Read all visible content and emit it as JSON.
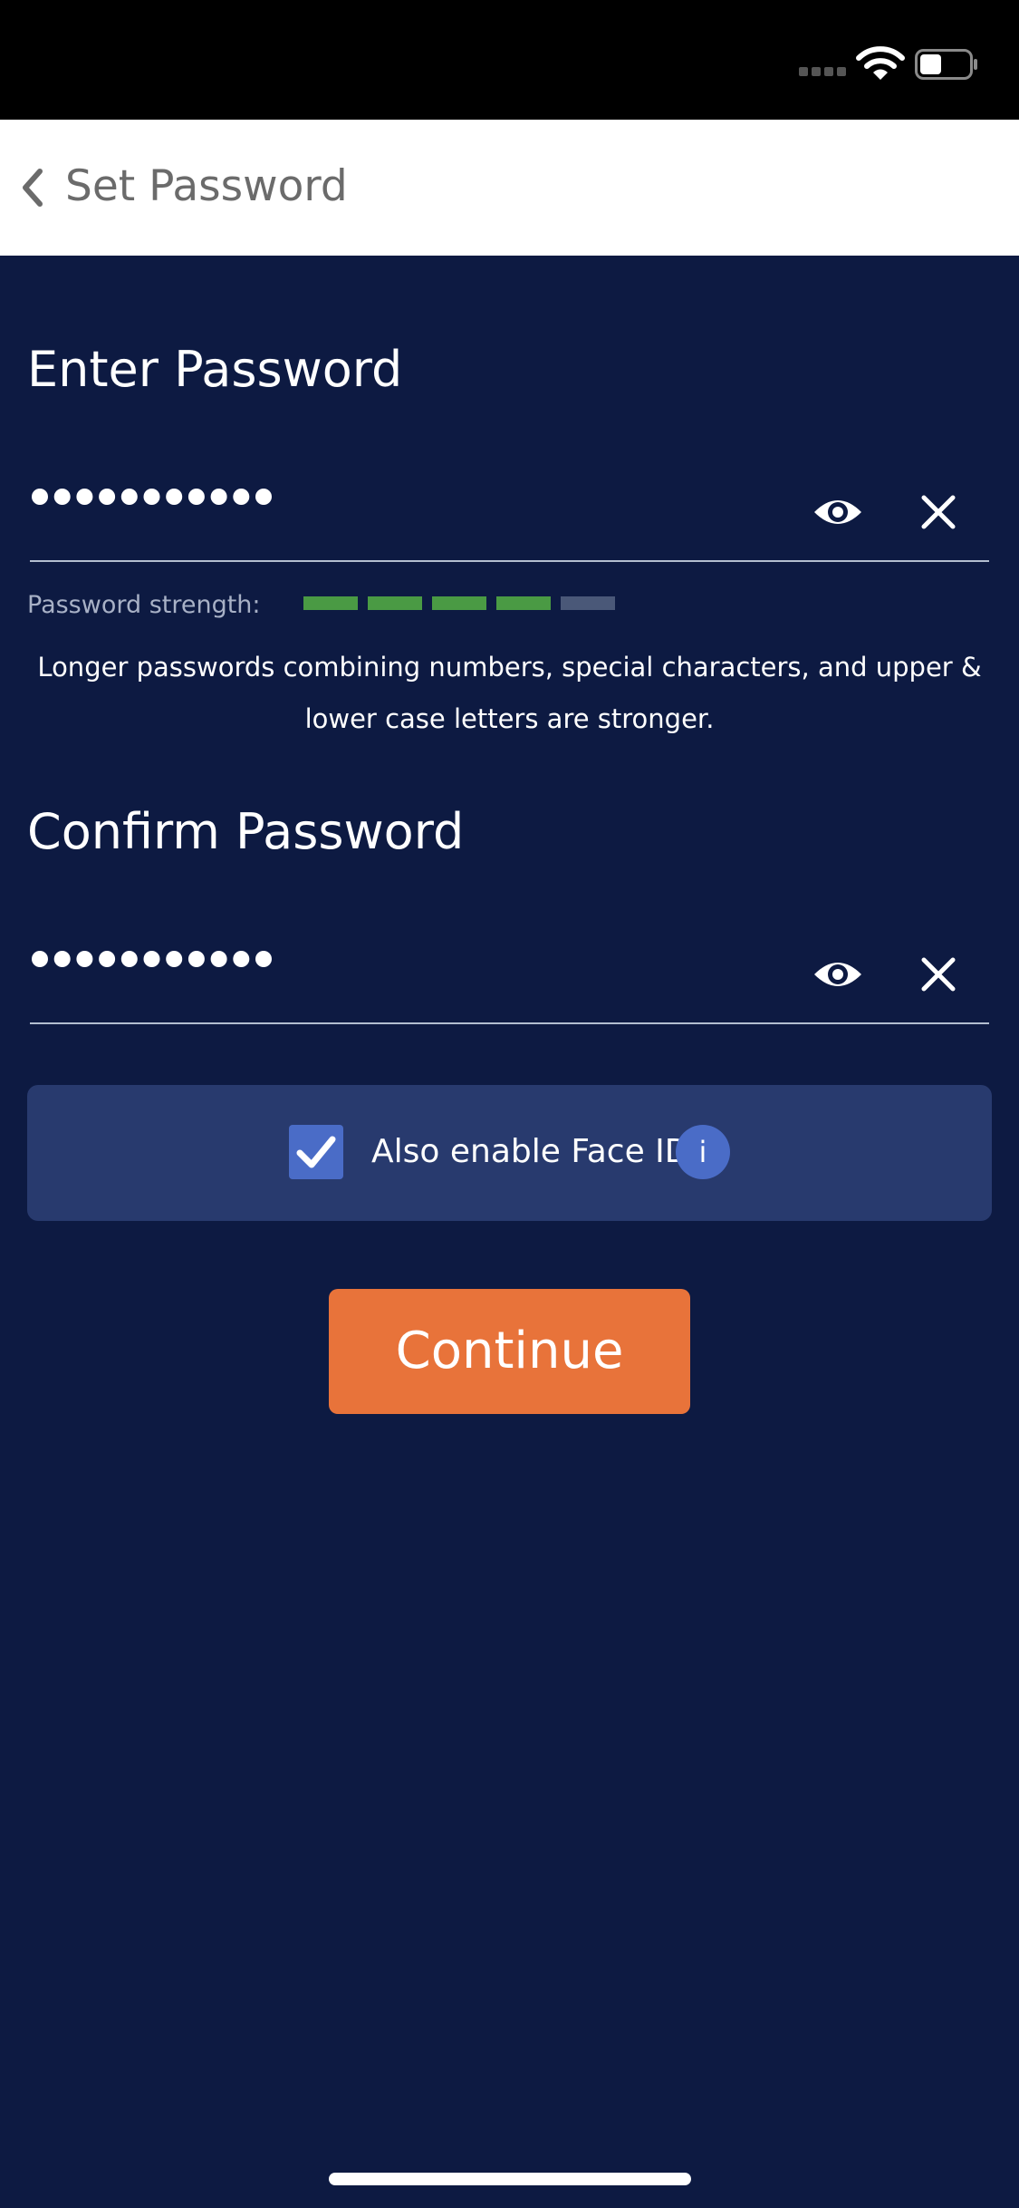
{
  "status_bar": {
    "signal_icon": "signal-icon",
    "wifi_icon": "wifi-icon",
    "battery_icon": "battery-icon",
    "battery_level": 0.45
  },
  "nav": {
    "back_icon": "chevron-left-icon",
    "title": "Set Password"
  },
  "password_field": {
    "title": "Enter Password",
    "masked_length": 11,
    "show_icon": "eye-icon",
    "clear_icon": "close-icon"
  },
  "strength": {
    "label": "Password strength:",
    "filled_segments": 4,
    "total_segments": 5,
    "filled_color": "#4a9a44",
    "empty_color": "#4a5878"
  },
  "hint": "Longer passwords combining numbers, special characters, and upper & lower case letters are stronger.",
  "confirm_field": {
    "title": "Confirm Password",
    "masked_length": 11,
    "show_icon": "eye-icon",
    "clear_icon": "close-icon"
  },
  "face_id": {
    "label": "Also enable Face ID",
    "checked": true,
    "info_label": "i"
  },
  "continue_label": "Continue",
  "colors": {
    "background": "#0d1a42",
    "panel": "#283a6e",
    "accent_blue": "#4a6cc7",
    "button_orange": "#e8733a"
  }
}
